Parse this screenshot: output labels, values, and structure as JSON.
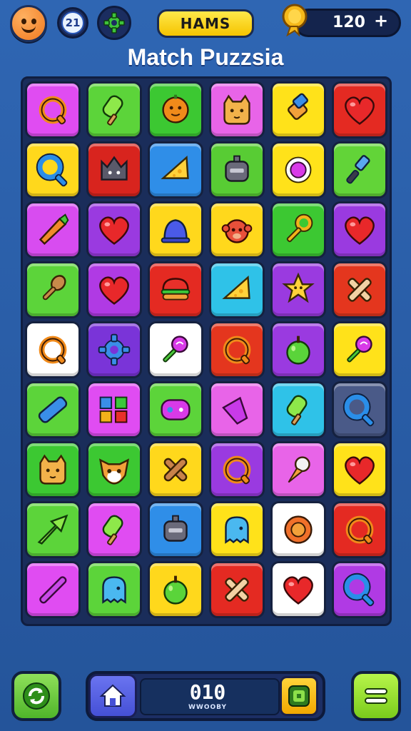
{
  "header": {
    "level_badge": "21",
    "player_name": "HAMS",
    "coins": "120",
    "coin_plus": "+"
  },
  "game": {
    "title": "Match Puzzsia"
  },
  "board": {
    "rows": 9,
    "cols": 6,
    "tiles": [
      [
        {
          "bg": "#e04cf2",
          "icon": "ring-icon"
        },
        {
          "bg": "#5cd43a",
          "icon": "popsicle-icon"
        },
        {
          "bg": "#3cc832",
          "icon": "orange-face-icon"
        },
        {
          "bg": "#e864e8",
          "icon": "cat-face-icon"
        },
        {
          "bg": "#ffe21a",
          "icon": "bottle-icon"
        },
        {
          "bg": "#e42a22",
          "icon": "heart-icon"
        }
      ],
      [
        {
          "bg": "#ffd81c",
          "icon": "magnifier-icon"
        },
        {
          "bg": "#d8241e",
          "icon": "crown-icon"
        },
        {
          "bg": "#2f8ee8",
          "icon": "cheese-icon"
        },
        {
          "bg": "#58cc34",
          "icon": "robot-icon"
        },
        {
          "bg": "#ffe21a",
          "icon": "candy-icon"
        },
        {
          "bg": "#62d438",
          "icon": "brush-icon"
        }
      ],
      [
        {
          "bg": "#d84cf0",
          "icon": "carrot-icon"
        },
        {
          "bg": "#9a3ae0",
          "icon": "heart-icon"
        },
        {
          "bg": "#ffd81c",
          "icon": "bell-icon"
        },
        {
          "bg": "#ffd81c",
          "icon": "monkey-icon"
        },
        {
          "bg": "#3cc832",
          "icon": "key-icon"
        },
        {
          "bg": "#9a3ae0",
          "icon": "heart-icon"
        }
      ],
      [
        {
          "bg": "#5cd43a",
          "icon": "spoon-icon"
        },
        {
          "bg": "#b03ae4",
          "icon": "heart-icon"
        },
        {
          "bg": "#e42a22",
          "icon": "burger-icon"
        },
        {
          "bg": "#2fc2e8",
          "icon": "cheese-icon"
        },
        {
          "bg": "#9a3ae0",
          "icon": "star-icon"
        },
        {
          "bg": "#e4361e",
          "icon": "cross-icon"
        }
      ],
      [
        {
          "bg": "#ffffff",
          "icon": "ring-icon"
        },
        {
          "bg": "#7a34d8",
          "icon": "gear-icon"
        },
        {
          "bg": "#ffffff",
          "icon": "lollipop-icon"
        },
        {
          "bg": "#e4361e",
          "icon": "ring-icon"
        },
        {
          "bg": "#9a3ae0",
          "icon": "apple-icon"
        },
        {
          "bg": "#ffe21a",
          "icon": "lollipop-icon"
        }
      ],
      [
        {
          "bg": "#5cd43a",
          "icon": "battery-icon"
        },
        {
          "bg": "#e04cf2",
          "icon": "blocks-icon"
        },
        {
          "bg": "#5cd43a",
          "icon": "gamepad-icon"
        },
        {
          "bg": "#e864e8",
          "icon": "bucket-icon"
        },
        {
          "bg": "#2fc2e8",
          "icon": "popsicle-icon"
        },
        {
          "bg": "#4a5a88",
          "icon": "magnifier-icon"
        }
      ],
      [
        {
          "bg": "#3cc832",
          "icon": "cat-face-icon"
        },
        {
          "bg": "#3cc832",
          "icon": "fox-face-icon"
        },
        {
          "bg": "#ffd81c",
          "icon": "bone-icon"
        },
        {
          "bg": "#9a3ae0",
          "icon": "ring-icon"
        },
        {
          "bg": "#e864e8",
          "icon": "ice-cream-icon"
        },
        {
          "bg": "#ffe21a",
          "icon": "heart-icon"
        }
      ],
      [
        {
          "bg": "#5cd43a",
          "icon": "arrow-icon"
        },
        {
          "bg": "#e04cf2",
          "icon": "popsicle-icon"
        },
        {
          "bg": "#2f8ee8",
          "icon": "robot-icon"
        },
        {
          "bg": "#ffe21a",
          "icon": "ghost-icon"
        },
        {
          "bg": "#ffffff",
          "icon": "cookie-icon"
        },
        {
          "bg": "#e42a22",
          "icon": "ring-icon"
        }
      ],
      [
        {
          "bg": "#e04cf2",
          "icon": "stick-icon"
        },
        {
          "bg": "#5cd43a",
          "icon": "ghost-icon"
        },
        {
          "bg": "#ffd81c",
          "icon": "apple-icon"
        },
        {
          "bg": "#e42a22",
          "icon": "cross-icon"
        },
        {
          "bg": "#ffffff",
          "icon": "heart-icon"
        },
        {
          "bg": "#b03ae4",
          "icon": "magnifier-icon"
        }
      ]
    ]
  },
  "footer": {
    "score": "010",
    "score_sub": "WWOOBY"
  }
}
